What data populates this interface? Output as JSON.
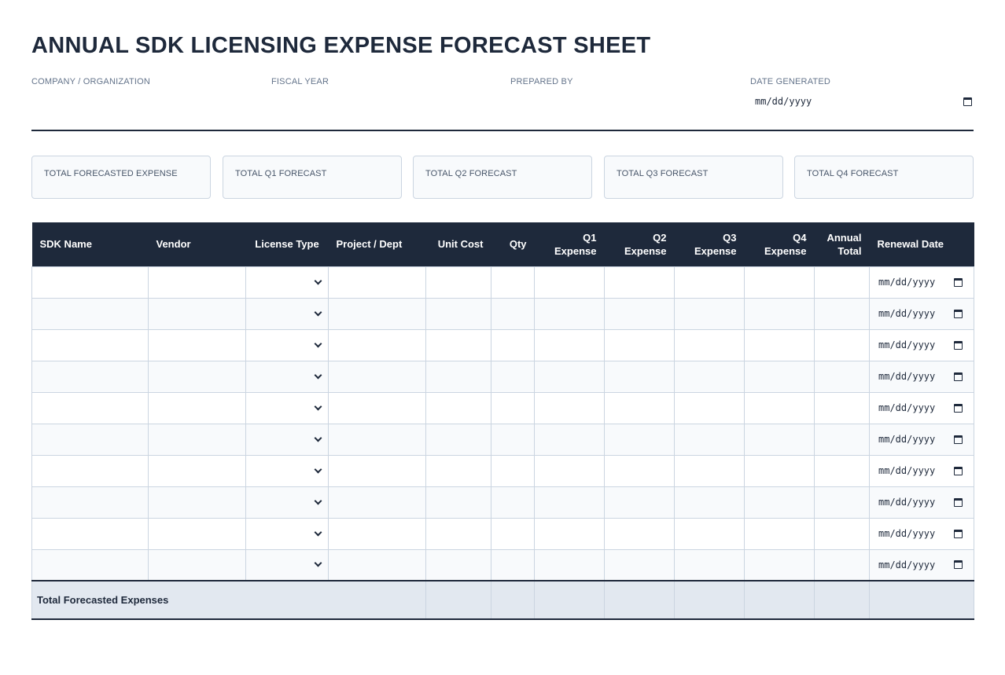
{
  "title": "ANNUAL SDK LICENSING EXPENSE FORECAST SHEET",
  "meta": {
    "company_label": "COMPANY / ORGANIZATION",
    "fiscal_year_label": "FISCAL YEAR",
    "prepared_by_label": "PREPARED BY",
    "date_generated_label": "DATE GENERATED",
    "date_placeholder": "mm/dd/yyyy"
  },
  "cards": {
    "total": "TOTAL FORECASTED EXPENSE",
    "q1": "TOTAL Q1 FORECAST",
    "q2": "TOTAL Q2 FORECAST",
    "q3": "TOTAL Q3 FORECAST",
    "q4": "TOTAL Q4 FORECAST"
  },
  "table": {
    "headers": {
      "sdk_name": "SDK Name",
      "vendor": "Vendor",
      "license_type": "License Type",
      "project": "Project / Dept",
      "unit_cost": "Unit Cost",
      "qty": "Qty",
      "q1": "Q1 Expense",
      "q2_line1": "Q2",
      "q2_line2": "Expense",
      "q3_line1": "Q3",
      "q3_line2": "Expense",
      "q4_line1": "Q4",
      "q4_line2": "Expense",
      "annual_line1": "Annual",
      "annual_line2": "Total",
      "renewal": "Renewal Date"
    },
    "row_count": 10,
    "date_placeholder": "mm/dd/yyyy",
    "footer_label": "Total Forecasted Expenses"
  },
  "icons": {
    "calendar": "calendar-icon",
    "dropdown": "chevron-down-icon"
  },
  "colors": {
    "header_bg": "#1e293b",
    "card_bg": "#f8fafc",
    "footer_bg": "#e2e8f0",
    "border": "#cbd5e1"
  }
}
